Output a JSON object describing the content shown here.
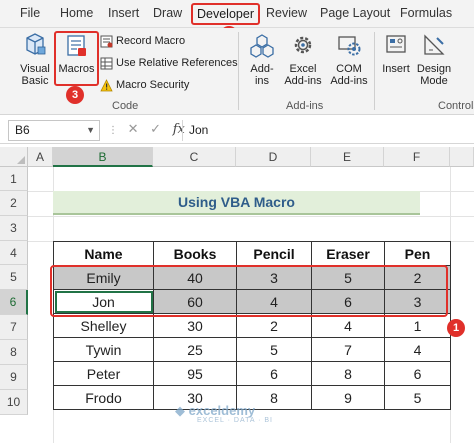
{
  "menu": {
    "tabs": [
      "File",
      "Home",
      "Insert",
      "Draw",
      "Developer",
      "Review",
      "Page Layout",
      "Formulas"
    ],
    "active": "Developer"
  },
  "ribbon": {
    "code_group": {
      "visual_basic_label": "Visual Basic",
      "macros_label": "Macros",
      "record_macro_label": "Record Macro",
      "relative_refs_label": "Use Relative References",
      "macro_security_label": "Macro Security",
      "group_label": "Code"
    },
    "addins_group": {
      "addins_label": "Add-ins",
      "excel_addins_label": "Excel Add-ins",
      "com_addins_label": "COM Add-ins",
      "group_label": "Add-ins"
    },
    "controls_group": {
      "insert_label": "Insert",
      "design_mode_label": "Design Mode",
      "group_label": "Controls"
    }
  },
  "formula_bar": {
    "name_box": "B6",
    "fx_label": "fx",
    "content": "Jon"
  },
  "sheet": {
    "columns": [
      "A",
      "B",
      "C",
      "D",
      "E",
      "F"
    ],
    "rows": [
      "1",
      "2",
      "3",
      "4",
      "5",
      "6",
      "7",
      "8",
      "9",
      "10"
    ],
    "title": "Using VBA Macro",
    "table_headers": [
      "Name",
      "Books",
      "Pencil",
      "Eraser",
      "Pen"
    ],
    "table_rows": [
      [
        "Emily",
        "40",
        "3",
        "5",
        "2"
      ],
      [
        "Jon",
        "60",
        "4",
        "6",
        "3"
      ],
      [
        "Shelley",
        "30",
        "2",
        "4",
        "1"
      ],
      [
        "Tywin",
        "25",
        "5",
        "7",
        "4"
      ],
      [
        "Peter",
        "95",
        "6",
        "8",
        "6"
      ],
      [
        "Frodo",
        "30",
        "8",
        "9",
        "5"
      ]
    ]
  },
  "annotations": {
    "step1": "1",
    "step2": "2",
    "step3": "3"
  },
  "watermark": {
    "name": "exceldemy",
    "tagline": "EXCEL · DATA · BI"
  },
  "colors": {
    "accent_red": "#e0302a",
    "excel_green": "#217346",
    "title_fill": "#e2efda",
    "highlight_rows": "#c8c8c8"
  }
}
